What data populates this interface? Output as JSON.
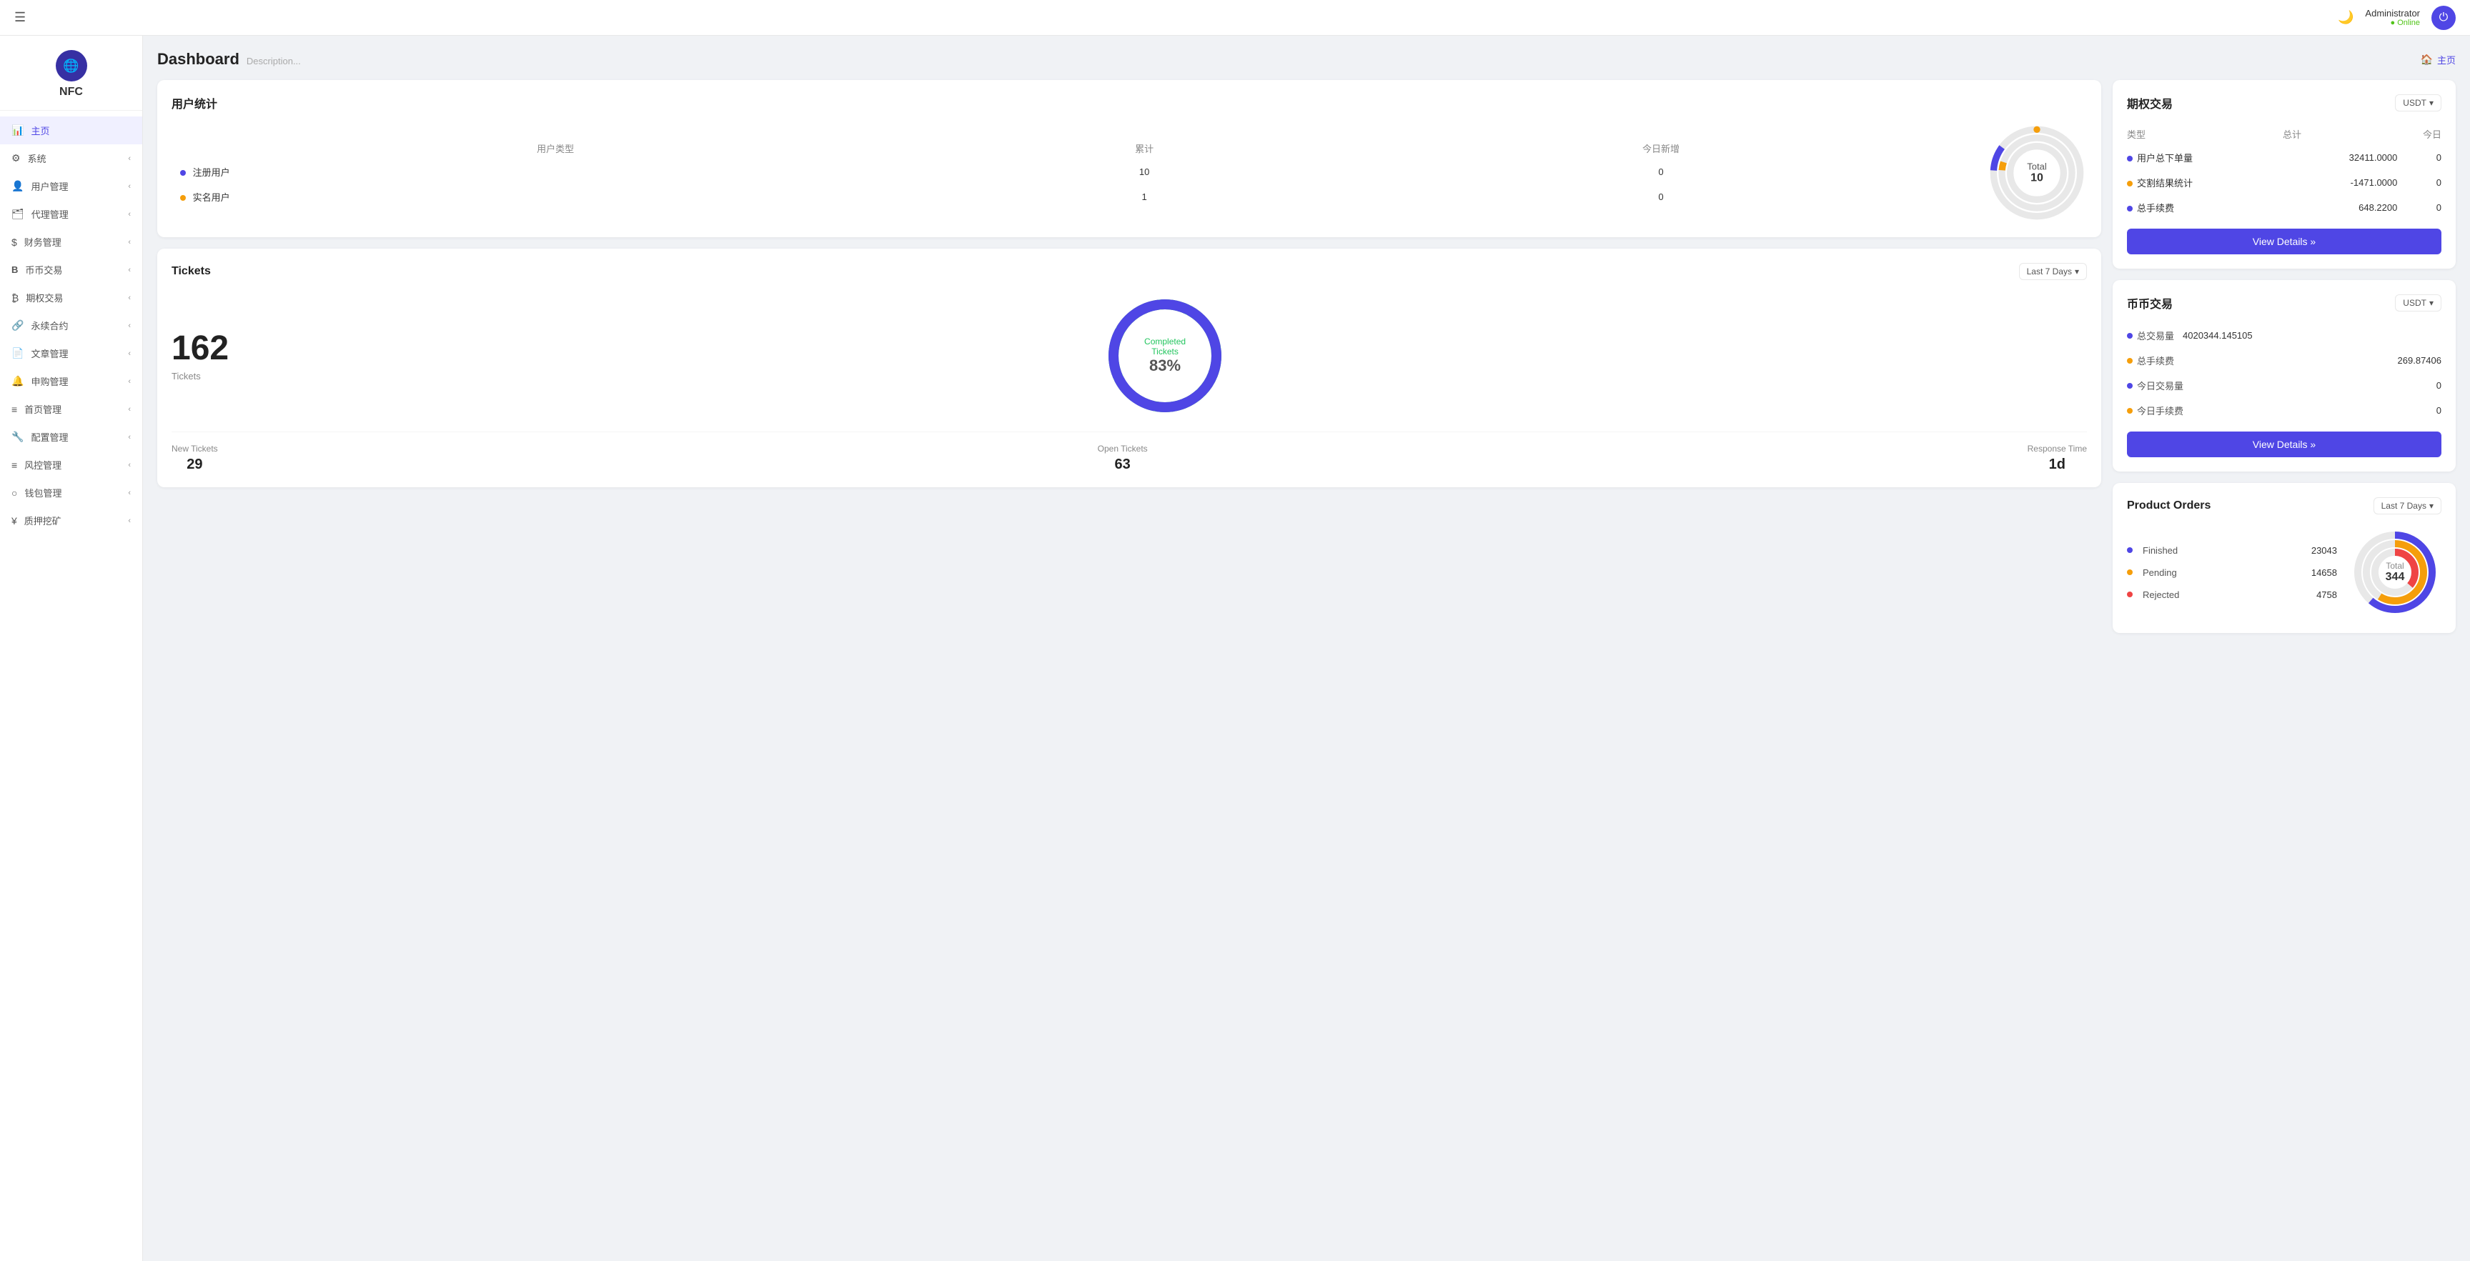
{
  "topbar": {
    "hamburger": "☰",
    "moon_icon": "🌙",
    "user_name": "Administrator",
    "user_status": "Online",
    "power_icon": "⏻"
  },
  "sidebar": {
    "logo_icon": "🌐",
    "logo_text": "NFC",
    "nav_items": [
      {
        "id": "home",
        "icon": "📊",
        "label": "主页",
        "active": true
      },
      {
        "id": "system",
        "icon": "⚙",
        "label": "系统",
        "has_arrow": true
      },
      {
        "id": "user-mgmt",
        "icon": "👤",
        "label": "用户管理",
        "has_arrow": true
      },
      {
        "id": "agent-mgmt",
        "icon": "🗂",
        "label": "代理管理",
        "has_arrow": true
      },
      {
        "id": "finance-mgmt",
        "icon": "$",
        "label": "财务管理",
        "has_arrow": true
      },
      {
        "id": "crypto-trade",
        "icon": "B",
        "label": "币币交易",
        "has_arrow": true
      },
      {
        "id": "futures-trade",
        "icon": "₿",
        "label": "期权交易",
        "has_arrow": true
      },
      {
        "id": "perpetual",
        "icon": "🔗",
        "label": "永续合约",
        "has_arrow": true
      },
      {
        "id": "article-mgmt",
        "icon": "📄",
        "label": "文章管理",
        "has_arrow": true
      },
      {
        "id": "subscribe-mgmt",
        "icon": "🔔",
        "label": "申购管理",
        "has_arrow": true
      },
      {
        "id": "homepage-mgmt",
        "icon": "≡",
        "label": "首页管理",
        "has_arrow": true
      },
      {
        "id": "config-mgmt",
        "icon": "🔧",
        "label": "配置管理",
        "has_arrow": true
      },
      {
        "id": "risk-mgmt",
        "icon": "≡",
        "label": "风控管理",
        "has_arrow": true
      },
      {
        "id": "wallet-mgmt",
        "icon": "○",
        "label": "钱包管理",
        "has_arrow": true
      },
      {
        "id": "mining",
        "icon": "¥",
        "label": "质押挖矿",
        "has_arrow": true
      }
    ]
  },
  "page": {
    "title": "Dashboard",
    "description": "Description...",
    "breadcrumb_icon": "🏠",
    "breadcrumb_label": "主页"
  },
  "user_stats": {
    "card_title": "用户统计",
    "col_type": "用户类型",
    "col_total": "累计",
    "col_today": "今日新增",
    "rows": [
      {
        "dot": "blue",
        "type": "注册用户",
        "total": "10",
        "today": "0"
      },
      {
        "dot": "orange",
        "type": "实名用户",
        "total": "1",
        "today": "0"
      }
    ],
    "donut_label": "Total",
    "donut_value": "10"
  },
  "tickets": {
    "card_title": "Tickets",
    "filter_label": "Last 7 Days",
    "total_number": "162",
    "total_label": "Tickets",
    "donut_label": "Completed Tickets",
    "donut_percent": "83%",
    "stats": [
      {
        "label": "New Tickets",
        "value": "29"
      },
      {
        "label": "Open Tickets",
        "value": "63"
      },
      {
        "label": "Response Time",
        "value": "1d"
      }
    ]
  },
  "futures_trade": {
    "card_title": "期权交易",
    "currency_select": "USDT",
    "col_type": "类型",
    "col_total": "总计",
    "col_today": "今日",
    "rows": [
      {
        "dot": "blue",
        "type": "用户总下单量",
        "total": "32411.0000",
        "today": "0"
      },
      {
        "dot": "orange",
        "type": "交割结果统计",
        "total": "-1471.0000",
        "today": "0",
        "neg": true
      },
      {
        "dot": "blue",
        "type": "总手续费",
        "total": "648.2200",
        "today": "0"
      }
    ],
    "btn_label": "View Details »"
  },
  "crypto_trade": {
    "card_title": "币币交易",
    "currency_select": "USDT",
    "rows": [
      {
        "dot": "blue",
        "label": "总交易量",
        "value": "4020344.145105",
        "full_row": true
      },
      {
        "dot": "orange",
        "label": "总手续费",
        "value": "269.87406"
      },
      {
        "dot": "blue",
        "label": "今日交易量",
        "value": "0"
      },
      {
        "dot": "orange",
        "label": "今日手续费",
        "value": "0"
      }
    ],
    "btn_label": "View Details »"
  },
  "product_orders": {
    "card_title": "Product Orders",
    "filter_label": "Last 7 Days",
    "rows": [
      {
        "dot": "blue",
        "label": "Finished",
        "value": "23043"
      },
      {
        "dot": "orange",
        "label": "Pending",
        "value": "14658"
      },
      {
        "dot": "red",
        "label": "Rejected",
        "value": "4758"
      }
    ],
    "donut_label": "Total",
    "donut_value": "344"
  }
}
